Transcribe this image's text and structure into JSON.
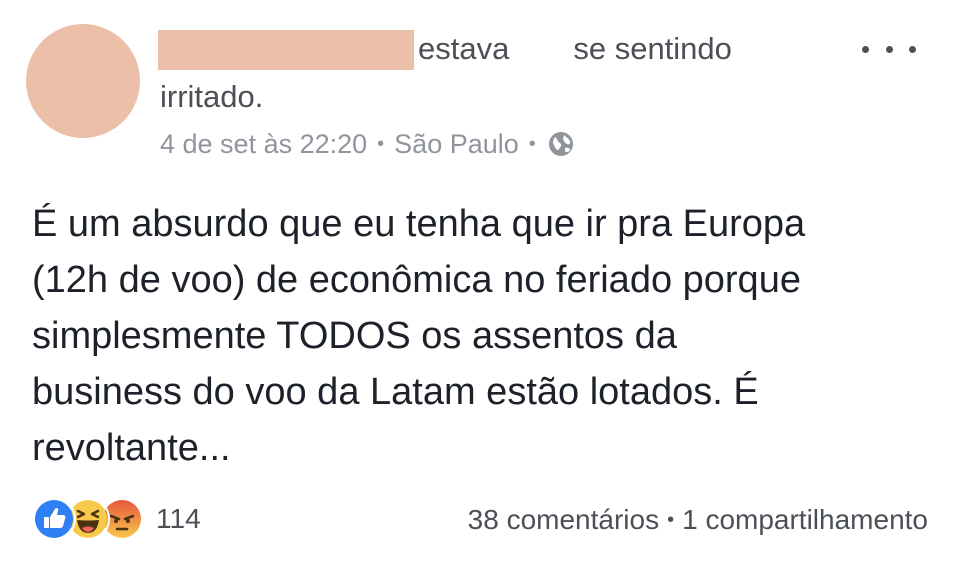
{
  "header": {
    "feeling_verb": "estava",
    "feeling_prefix": "se sentindo",
    "feeling": "irritado.",
    "timestamp": "4 de set às 22:20",
    "location": "São Paulo",
    "separator": "•",
    "privacy_icon": "globe-icon"
  },
  "post": {
    "lines": [
      "É um absurdo que eu tenha que ir pra Europa",
      "(12h de voo) de econômica no feriado porque",
      "simplesmente TODOS os assentos da",
      "business do voo da Latam estão lotados. É",
      "revoltante..."
    ]
  },
  "footer": {
    "reaction_icons": [
      "like-icon",
      "haha-icon",
      "angry-icon"
    ],
    "reaction_count": "114",
    "comments": "38 comentários",
    "separator": "•",
    "shares": "1 compartilhamento"
  },
  "colors": {
    "redaction": "#ecbfa8",
    "meta_text": "#90949c",
    "body_text": "#1d2129",
    "like_blue": "#2f7ff5",
    "haha_yellow": "#f7c94b",
    "angry_red": "#e8573f"
  }
}
